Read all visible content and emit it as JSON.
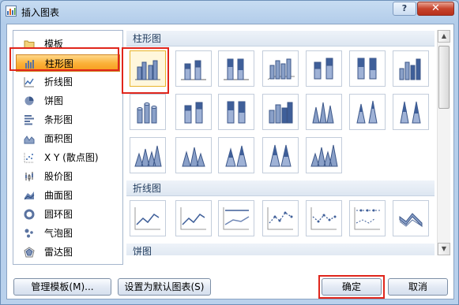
{
  "window": {
    "title": "插入图表",
    "help_label": "?",
    "close_label": "✕"
  },
  "sidebar": {
    "items": [
      {
        "label": "模板",
        "icon": "folder-icon"
      },
      {
        "label": "柱形图",
        "icon": "column-chart-icon",
        "selected": true
      },
      {
        "label": "折线图",
        "icon": "line-chart-icon"
      },
      {
        "label": "饼图",
        "icon": "pie-chart-icon"
      },
      {
        "label": "条形图",
        "icon": "bar-chart-icon"
      },
      {
        "label": "面积图",
        "icon": "area-chart-icon"
      },
      {
        "label": "X Y (散点图)",
        "icon": "scatter-chart-icon"
      },
      {
        "label": "股价图",
        "icon": "stock-chart-icon"
      },
      {
        "label": "曲面图",
        "icon": "surface-chart-icon"
      },
      {
        "label": "圆环图",
        "icon": "doughnut-chart-icon"
      },
      {
        "label": "气泡图",
        "icon": "bubble-chart-icon"
      },
      {
        "label": "雷达图",
        "icon": "radar-chart-icon"
      }
    ]
  },
  "gallery": {
    "sections": [
      {
        "title": "柱形图"
      },
      {
        "title": "折线图"
      },
      {
        "title": "饼图"
      }
    ],
    "selected_tile": 0
  },
  "buttons": {
    "manage_templates": "管理模板(M)...",
    "set_default": "设置为默认图表(S)",
    "ok": "确定",
    "cancel": "取消"
  },
  "colors": {
    "accent": "#e0261c",
    "selected_orange": "#f7a21f",
    "chart_blue": "#4a6fa5"
  }
}
